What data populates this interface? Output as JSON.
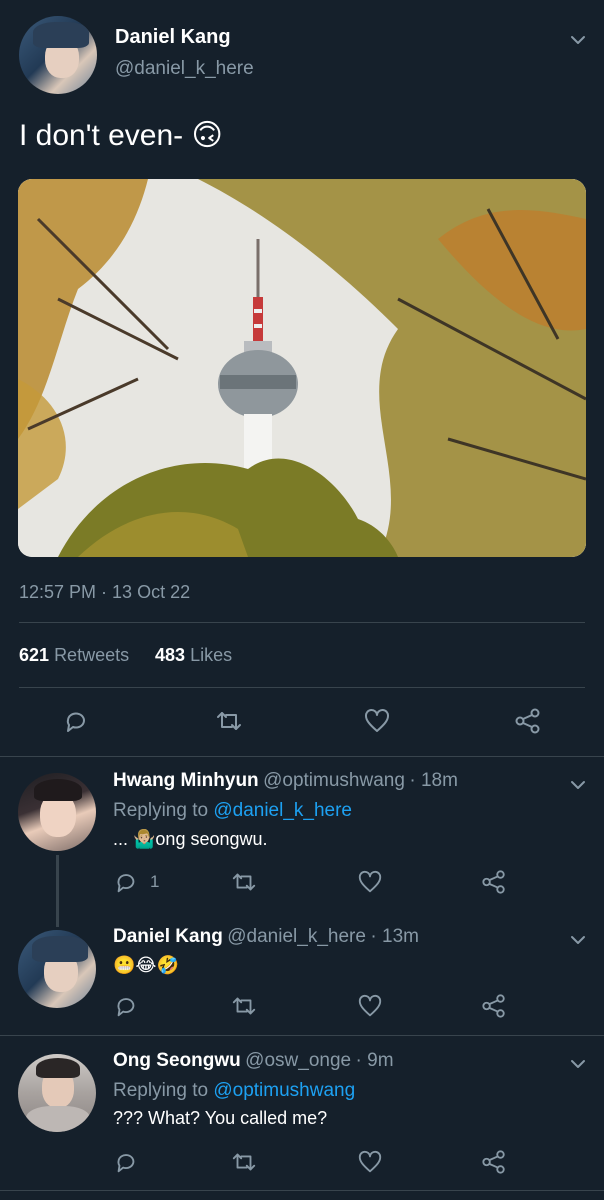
{
  "main_tweet": {
    "author_name": "Daniel Kang",
    "author_handle": "@daniel_k_here",
    "text": "I don't even- 🙃",
    "timestamp": "12:57 PM · 13 Oct 22",
    "retweet_count": "621",
    "retweet_label": "Retweets",
    "like_count": "483",
    "like_label": "Likes",
    "image_alt": "N Seoul Tower framed by autumn trees"
  },
  "replies": [
    {
      "author_name": "Hwang Minhyun",
      "author_handle": "@optimushwang",
      "time": "· 18m",
      "replying_prefix": "Replying to",
      "replying_handle": "@daniel_k_here",
      "text": "... 🤷🏼‍♂️ong seongwu.",
      "reply_count": "1"
    },
    {
      "author_name": "Daniel Kang",
      "author_handle": "@daniel_k_here",
      "time": "· 13m",
      "text": "😬😂🤣",
      "reply_count": ""
    },
    {
      "author_name": "Ong Seongwu",
      "author_handle": "@osw_onge",
      "time": "· 9m",
      "replying_prefix": "Replying to",
      "replying_handle": "@optimushwang",
      "text": "??? What? You called me?",
      "reply_count": ""
    }
  ],
  "colors": {
    "background": "#15202b",
    "divider": "#38444d",
    "secondary_text": "#8899a6",
    "link": "#1da1f2"
  }
}
